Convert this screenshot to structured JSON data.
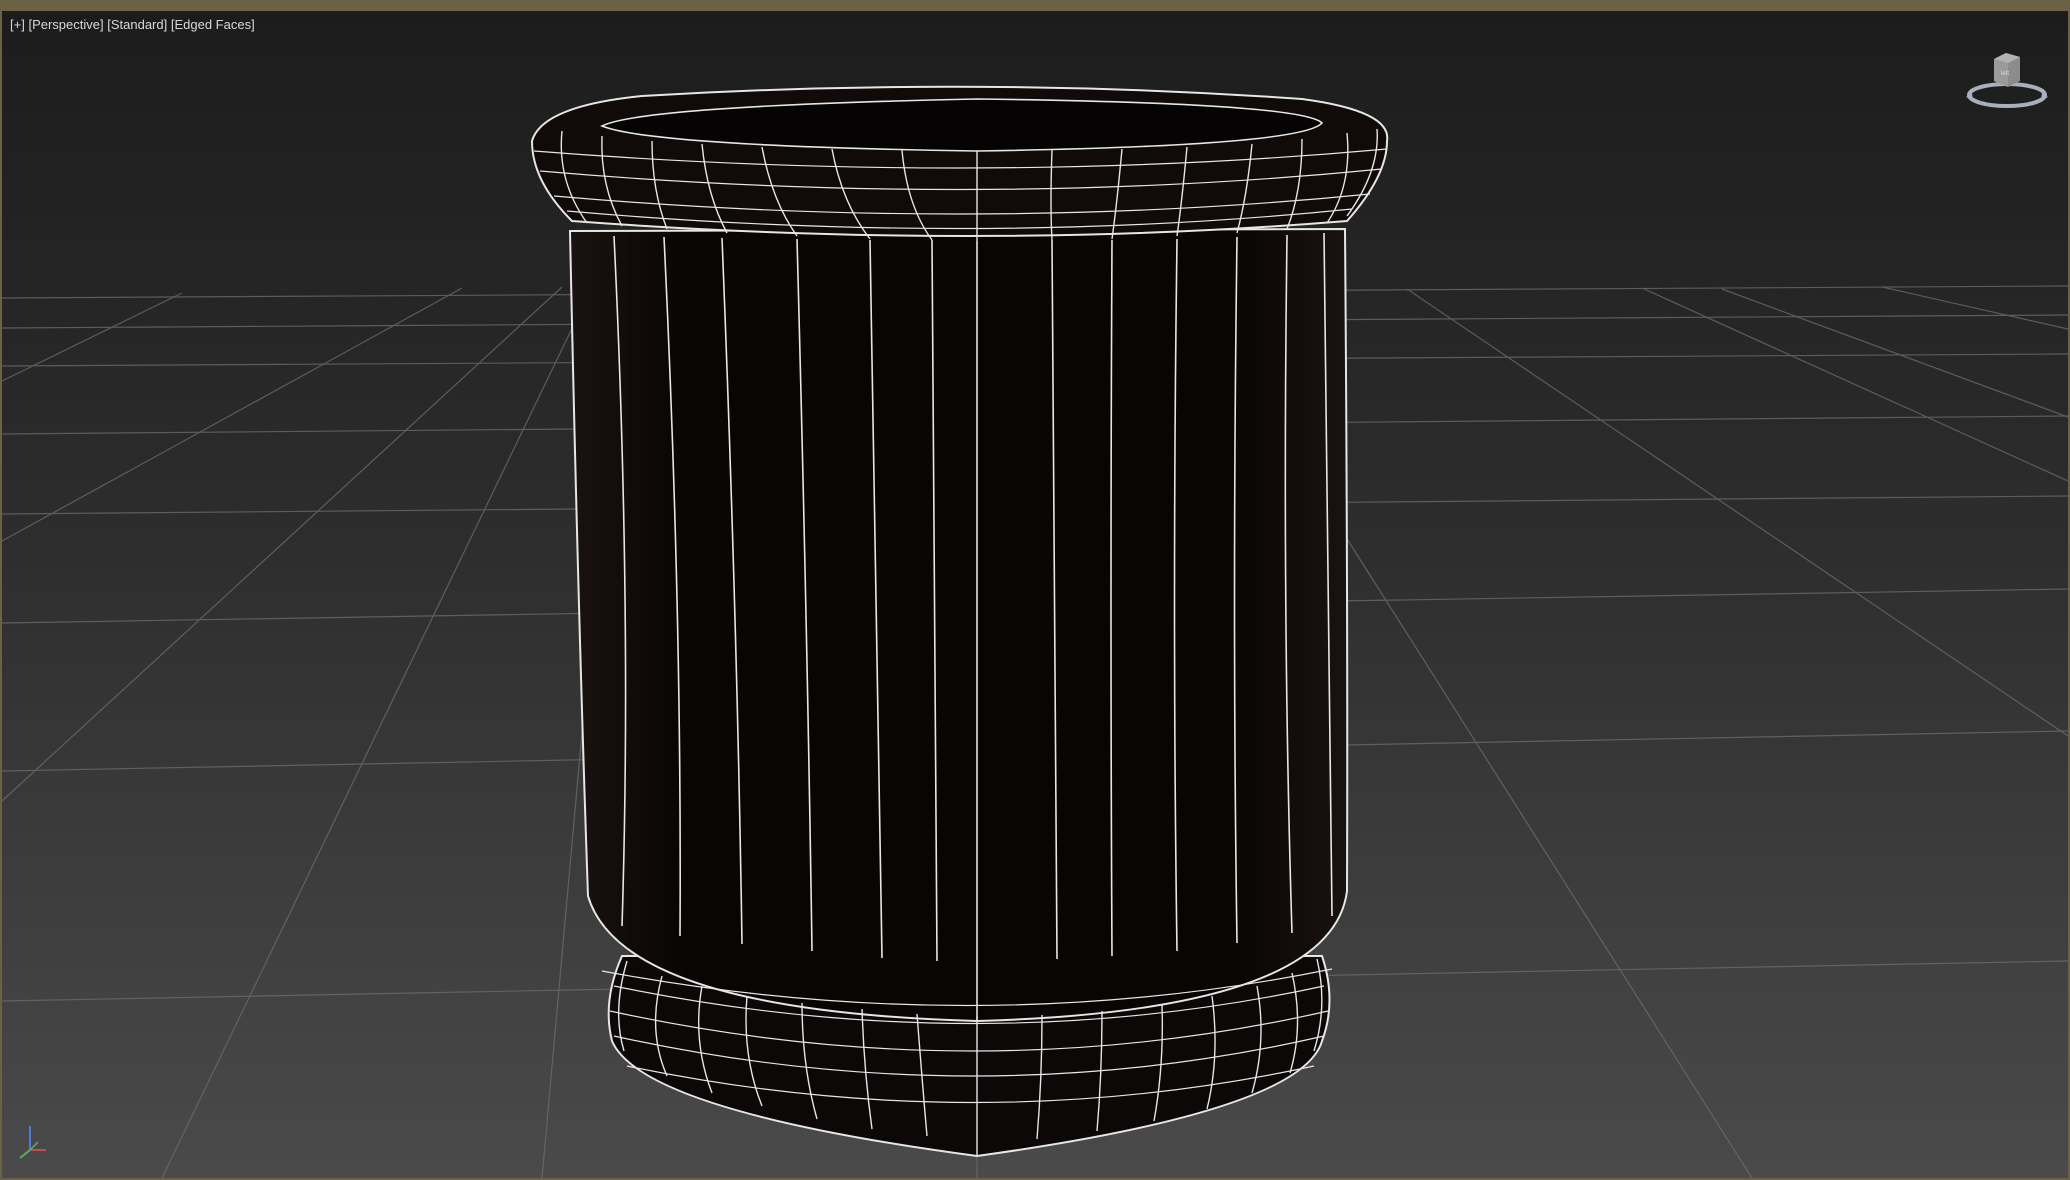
{
  "viewport": {
    "label": {
      "plus": "[+]",
      "view": "[Perspective]",
      "shading": "[Standard]",
      "edged": "[Edged Faces]"
    },
    "viewcube_face": "left"
  },
  "colors": {
    "background_top": "#1c1c1c",
    "background_bottom": "#474747",
    "grid": "#666666",
    "wire": "#e8e8e8",
    "mesh": "#0b0706",
    "border": "#6b6246"
  },
  "icons": [
    "viewcube-icon",
    "axis-gizmo-icon"
  ]
}
